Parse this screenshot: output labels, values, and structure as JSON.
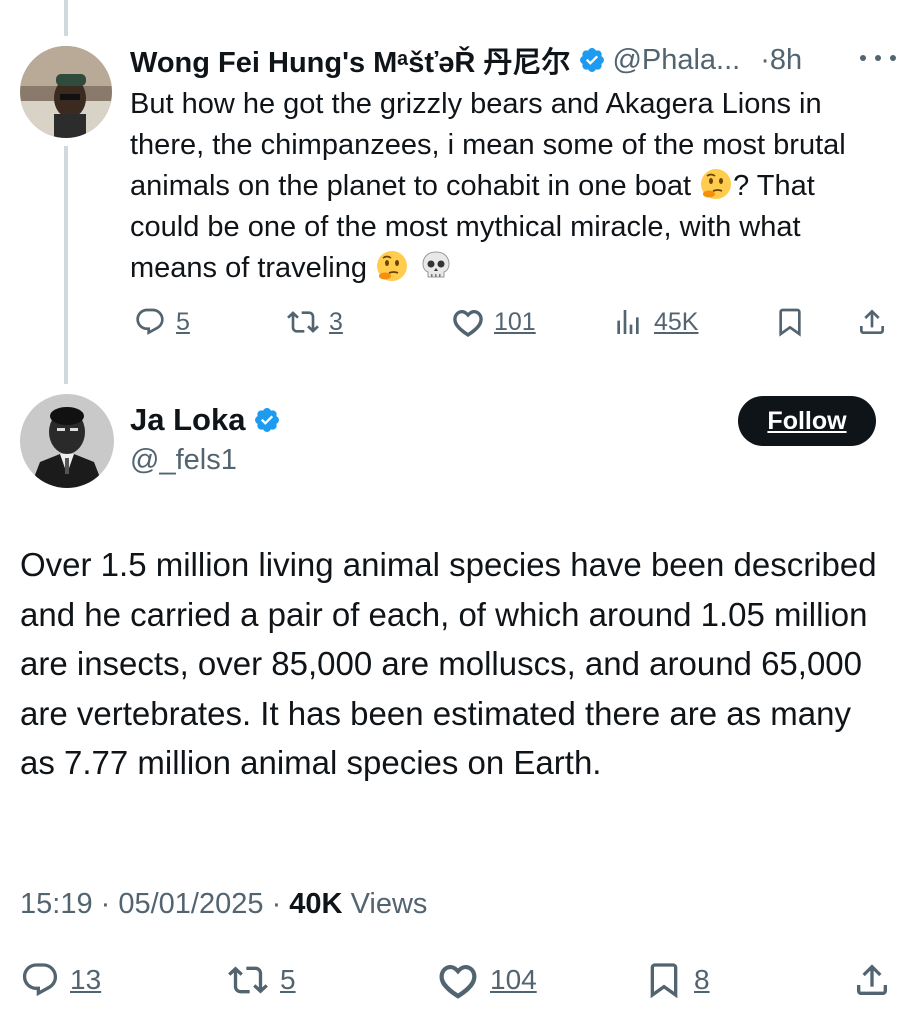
{
  "reply_tweet": {
    "display_name": "Wong Fei Hung's MᵃšťəŘ 丹尼尔",
    "handle": "@Phala...",
    "time": "·8h",
    "text_main": "But how he got the grizzly bears and Akagera Lions in there, the chimpanzees, i mean some of the most brutal animals on the planet to cohabit in one boat",
    "text_after_emoji": "? That could be one of the most mythical miracle, with what means of traveling",
    "emoji_1": "thinking-face",
    "emoji_2": "thinking-face",
    "emoji_3": "skull",
    "actions": {
      "replies": "5",
      "retweets": "3",
      "likes": "101",
      "views": "45K"
    }
  },
  "main_tweet": {
    "display_name": "Ja Loka",
    "handle": "@_fels1",
    "follow_label": "Follow",
    "text": "Over 1.5 million living animal species have been described and he carried a pair of each, of which around 1.05 million are insects, over 85,000 are molluscs, and around 65,000 are vertebrates. It has been estimated there are as many as 7.77 million animal species on Earth.",
    "time": "15:19",
    "date": "05/01/2025",
    "views_count": "40K",
    "views_label": "Views",
    "actions": {
      "replies": "13",
      "retweets": "5",
      "likes": "104",
      "bookmarks": "8"
    }
  },
  "colors": {
    "text": "#0f1419",
    "secondary": "#536471",
    "verified": "#1d9bf0",
    "thread_line": "#cfd9de"
  }
}
